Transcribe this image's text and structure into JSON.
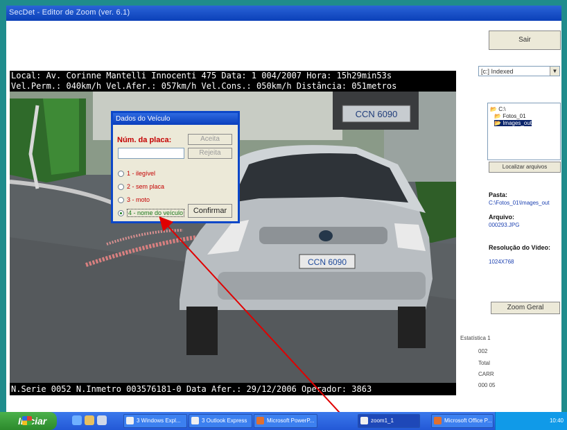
{
  "window": {
    "title": "SecDet - Editor de Zoom (ver. 6.1)"
  },
  "overlay": {
    "line1": "Local: Av. Corinne Mantelli Innocenti     475    Data: 1 004/2007  Hora: 15h29min53s",
    "line2": "Vel.Perm.: 040km/h  Vel.Afer.: 057km/h  Vel.Cons.: 050km/h  Distância: 051metros",
    "line3": "N.Serie  0052  N.Inmetro  003576181-0  Data Afer.: 29/12/2006  Operador: 3863"
  },
  "plate": {
    "zoom_text": "CCN 6090",
    "car_text": "CCN 6090"
  },
  "dialog": {
    "title": "Dados do Veículo",
    "plate_label": "Núm. da placa:",
    "plate_value": "",
    "btn_aceita": "Aceita",
    "btn_rejeita": "Rejeita",
    "options": [
      "1 - ilegível",
      "2 - sem placa",
      "3 - moto",
      "4 - nome do veículo"
    ],
    "selected_option_index": 3,
    "confirm_label": "Confirmar"
  },
  "right_panel": {
    "top_button": "Sair",
    "combo_value": "[c:] Indexed",
    "tree": [
      "C:\\",
      "Fotos_01",
      "Images_out"
    ],
    "tree_selected_index": 2,
    "apply_button": "Localizar arquivos",
    "pasta_label": "Pasta:",
    "pasta_value": "C:\\Fotos_01\\Images_out",
    "arquivo_label": "Arquivo:",
    "arquivo_value": "000293.JPG",
    "resolucao_label": "Resolução do Vídeo:",
    "resolucao_value": "1024X768",
    "zoom_button": "Zoom Geral",
    "stats_title": "Estatística 1",
    "stats": [
      "002",
      "Total",
      "CARR",
      "000 05"
    ]
  },
  "taskbar": {
    "start_label": "Iniciar",
    "items": [
      "3 Windows Expl...",
      "3 Outlook Express",
      "Microsoft PowerP...",
      "zoom1_1",
      "Microsoft Office P..."
    ],
    "active_index": 3,
    "clock": "10:40"
  },
  "colors": {
    "frame": "#1f8c8c",
    "titlebar": "#0b40b8",
    "dialog_border": "#0c47c8",
    "arrow": "#e00000",
    "taskbar": "#2358d6"
  }
}
